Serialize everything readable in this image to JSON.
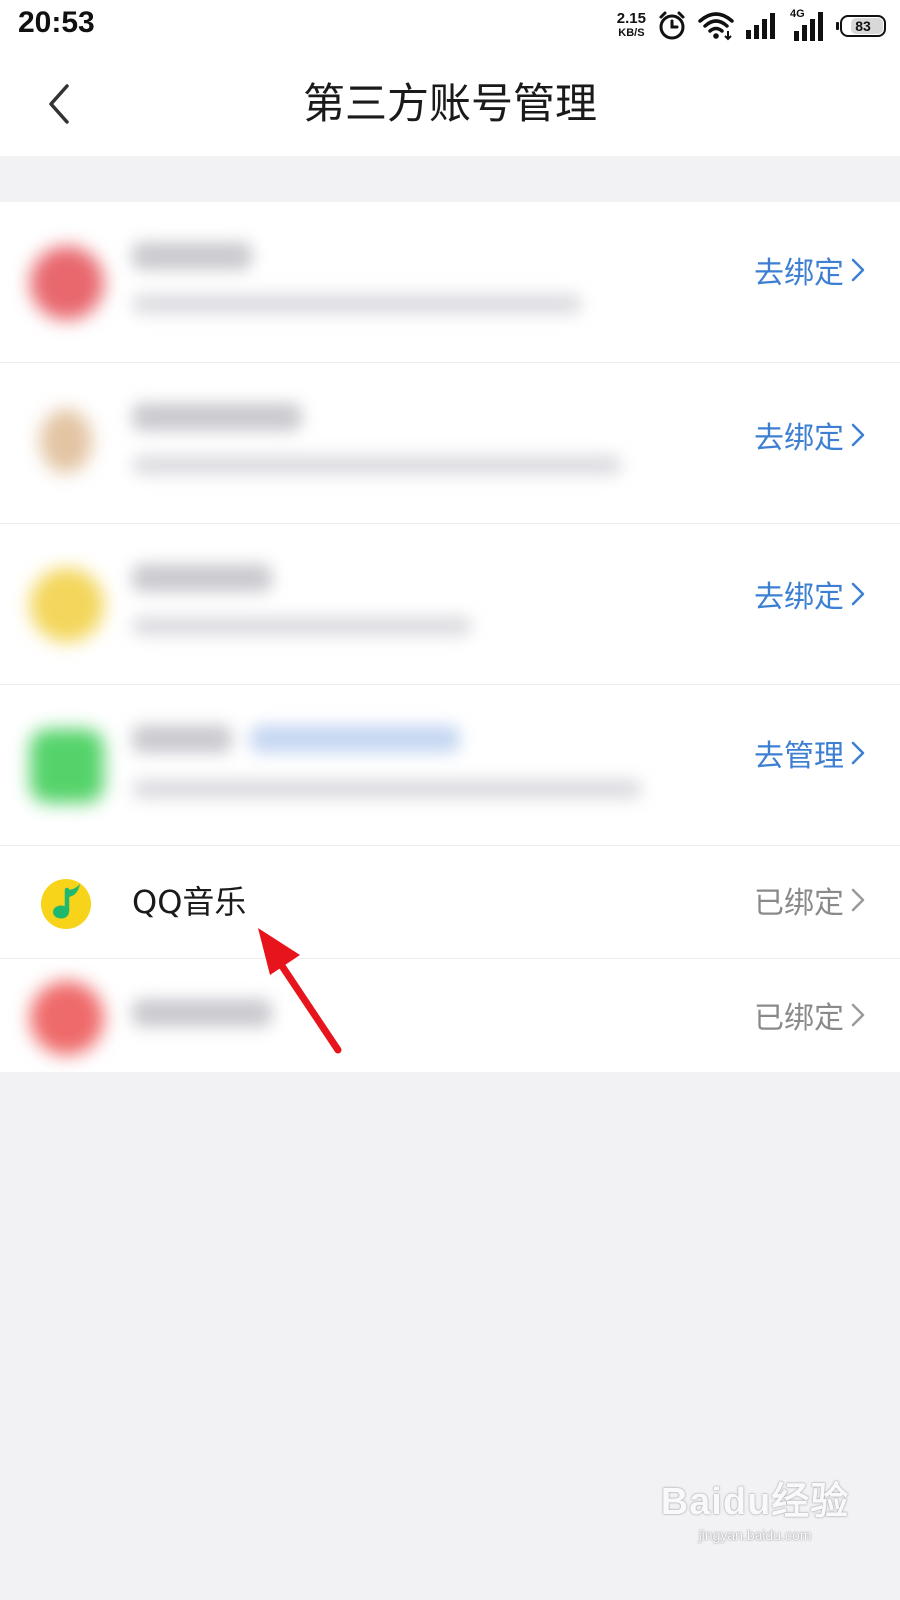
{
  "status_bar": {
    "time": "20:53",
    "net_speed_value": "2.15",
    "net_speed_unit": "KB/S",
    "network_type": "4G",
    "battery_level": "83"
  },
  "header": {
    "title": "第三方账号管理",
    "back_icon": "chevron-left-icon"
  },
  "accounts": [
    {
      "name": "",
      "action_label": "去绑定",
      "action_style": "blue",
      "icon_color": "#e8686e"
    },
    {
      "name": "",
      "action_label": "去绑定",
      "action_style": "blue",
      "icon_color": "#e6b26e"
    },
    {
      "name": "",
      "action_label": "去绑定",
      "action_style": "blue",
      "icon_color": "#f3d65b"
    },
    {
      "name": "",
      "action_label": "去管理",
      "action_style": "blue",
      "icon_color": "#55d36a"
    },
    {
      "name": "QQ音乐",
      "action_label": "已绑定",
      "action_style": "gray",
      "icon": "qq-music-icon"
    },
    {
      "name": "",
      "action_label": "已绑定",
      "action_style": "gray",
      "icon_color": "#ef6a6a"
    }
  ],
  "colors": {
    "link_blue": "#3d7fd2",
    "bound_gray": "#8a8a8a",
    "annotation_red": "#e8141b",
    "page_background": "#f2f2f5"
  },
  "watermark": {
    "brand": "Baidu经验",
    "url": "jingyan.baidu.com"
  }
}
